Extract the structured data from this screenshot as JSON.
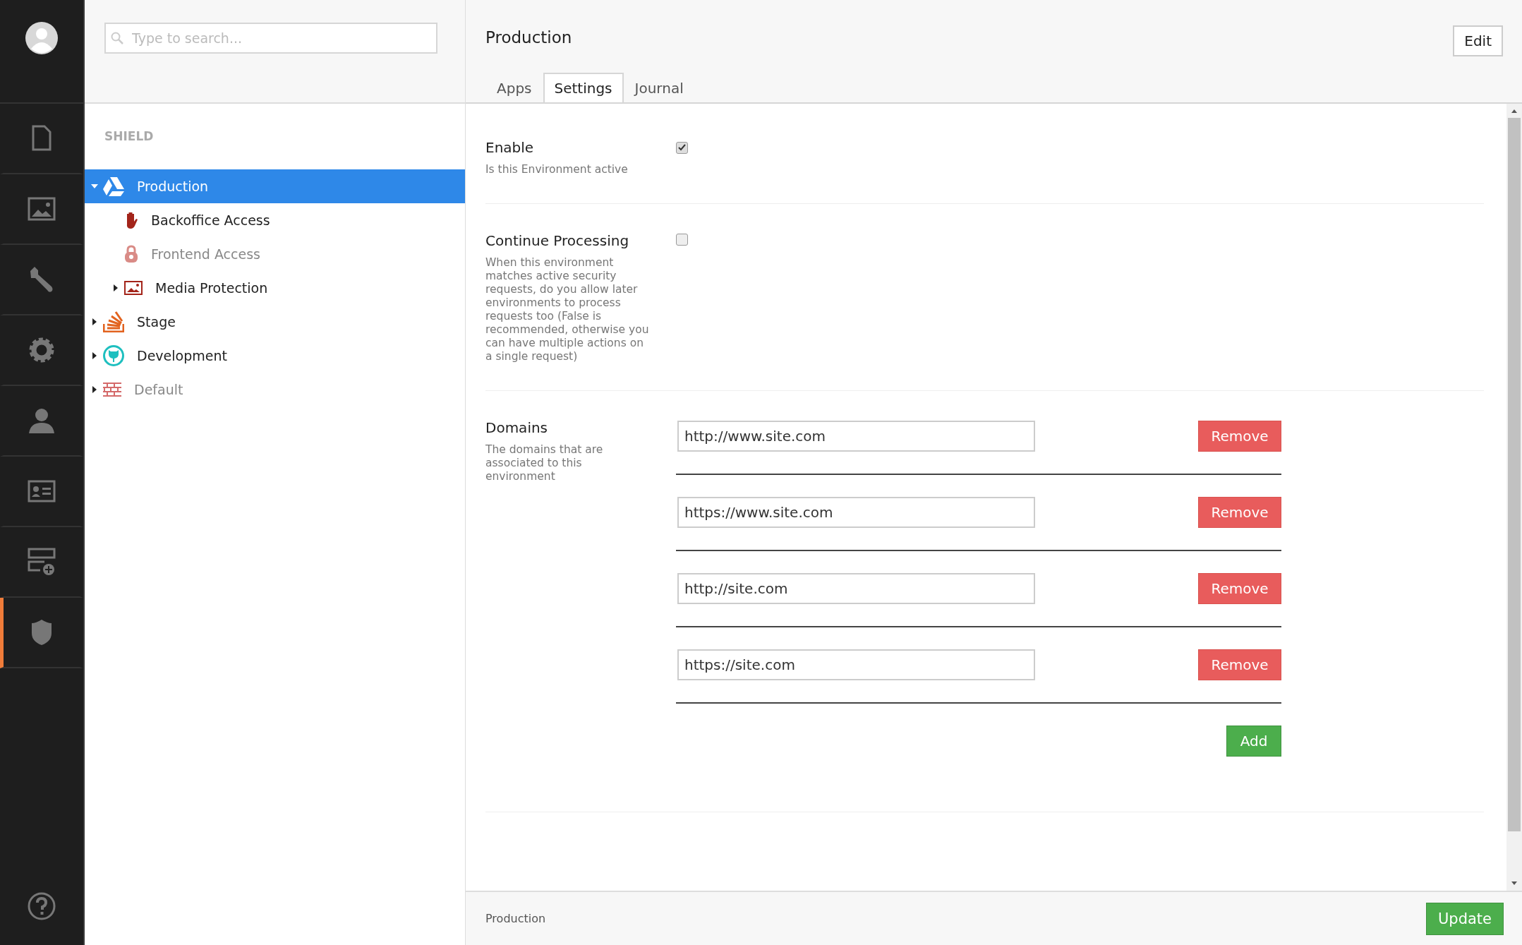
{
  "nav": {
    "items": [
      {
        "selected": false
      },
      {
        "selected": false
      },
      {
        "selected": false
      },
      {
        "selected": false
      },
      {
        "selected": false
      },
      {
        "selected": false
      },
      {
        "selected": false
      },
      {
        "selected": true
      }
    ]
  },
  "search": {
    "placeholder": "Type to search..."
  },
  "tree": {
    "heading": "SHIELD",
    "items": [
      {
        "label": "Production",
        "selected": true,
        "disabled": false,
        "expanded": true,
        "children": [
          {
            "label": "Backoffice Access",
            "selected": false,
            "disabled": false
          },
          {
            "label": "Frontend Access",
            "selected": false,
            "disabled": true
          },
          {
            "label": "Media Protection",
            "selected": false,
            "disabled": false,
            "expanded": false
          }
        ]
      },
      {
        "label": "Stage",
        "selected": false,
        "disabled": false,
        "expanded": false
      },
      {
        "label": "Development",
        "selected": false,
        "disabled": false,
        "expanded": false
      },
      {
        "label": "Default",
        "selected": false,
        "disabled": true,
        "expanded": false
      }
    ]
  },
  "header": {
    "title": "Production",
    "edit_button": "Edit"
  },
  "tabs": [
    {
      "label": "Apps",
      "selected": false
    },
    {
      "label": "Settings",
      "selected": true
    },
    {
      "label": "Journal",
      "selected": false
    }
  ],
  "settings": [
    {
      "kind": "checkbox",
      "label": "Enable",
      "description": "Is this Environment active",
      "checked": true
    },
    {
      "kind": "checkbox",
      "label": "Continue Processing",
      "description": "When this environment matches active security requests, do you allow later environments to process requests too (False is recommended, otherwise you can have multiple actions on a single request)",
      "checked": false
    },
    {
      "kind": "domains",
      "label": "Domains",
      "description": "The domains that are associated to this environment",
      "domains": [
        {
          "value": "http://www.site.com",
          "button": "Remove"
        },
        {
          "value": "https://www.site.com",
          "button": "Remove"
        },
        {
          "value": "http://site.com",
          "button": "Remove"
        },
        {
          "value": "https://site.com",
          "button": "Remove"
        }
      ],
      "add_button": "Add"
    }
  ],
  "footer": {
    "status": "Production",
    "update_button": "Update"
  }
}
